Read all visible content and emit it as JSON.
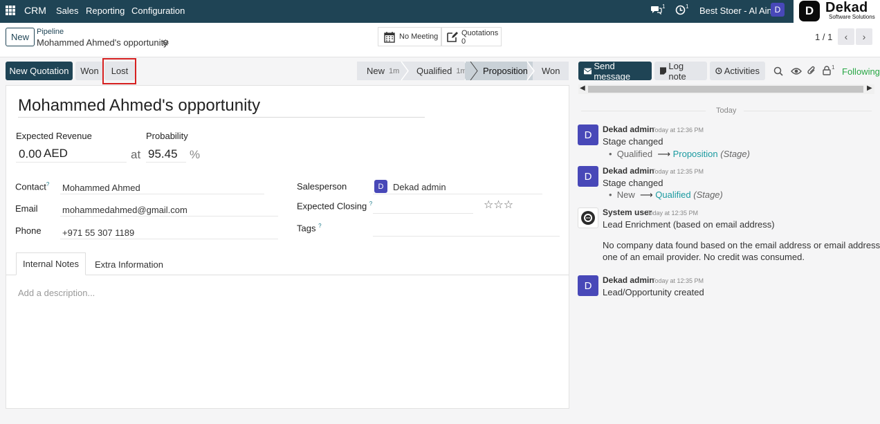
{
  "navbar": {
    "brand": "CRM",
    "menu": [
      "Sales",
      "Reporting",
      "Configuration"
    ],
    "messages_count": "1",
    "activities_count": "1",
    "company": "Best Stoer - Al Ain",
    "user_initial": "D",
    "logo_initial": "D",
    "logo_name": "Dekad",
    "logo_sub": "Software Solutions"
  },
  "control": {
    "new_label": "New",
    "breadcrumb_parent": "Pipeline",
    "breadcrumb_current": "Mohammed Ahmed's opportunity",
    "meeting_label": "No Meeting",
    "quotations_label": "Quotations",
    "quotations_count": "0",
    "pager": "1 / 1"
  },
  "actions": {
    "new_quotation": "New Quotation",
    "won": "Won",
    "lost": "Lost"
  },
  "stages": [
    {
      "name": "New",
      "duration": "1m"
    },
    {
      "name": "Qualified",
      "duration": "1m"
    },
    {
      "name": "Proposition",
      "duration": ""
    },
    {
      "name": "Won",
      "duration": ""
    }
  ],
  "form": {
    "title": "Mohammed Ahmed's opportunity",
    "expected_revenue_label": "Expected Revenue",
    "expected_revenue": "0.00",
    "currency": "AED",
    "at": "at",
    "probability_label": "Probability",
    "probability": "95.45",
    "percent": "%",
    "contact_label": "Contact",
    "contact": "Mohammed Ahmed",
    "email_label": "Email",
    "email": "mohammedahmed@gmail.com",
    "phone_label": "Phone",
    "phone": "+971 55 307 1189",
    "salesperson_label": "Salesperson",
    "salesperson": "Dekad admin",
    "salesperson_initial": "D",
    "expected_closing_label": "Expected Closing",
    "tags_label": "Tags",
    "help": "?",
    "tabs": [
      "Internal Notes",
      "Extra Information"
    ],
    "description_placeholder": "Add a description..."
  },
  "chatter": {
    "send_message": "Send message",
    "log_note": "Log note",
    "activities": "Activities",
    "followers_count": "1",
    "following": "Following",
    "today": "Today",
    "messages": [
      {
        "author": "Dekad admin",
        "time": "Today at 12:36 PM",
        "initial": "D",
        "text": "Stage changed",
        "from": "Qualified",
        "to": "Proposition",
        "field": "(Stage)"
      },
      {
        "author": "Dekad admin",
        "time": "Today at 12:35 PM",
        "initial": "D",
        "text": "Stage changed",
        "from": "New",
        "to": "Qualified",
        "field": "(Stage)"
      },
      {
        "author": "System user",
        "time": "Today at 12:35 PM",
        "text": "Lead Enrichment (based on email address)",
        "body1": "No company data found based on the email address or email address is",
        "body2": "one of an email provider. No credit was consumed."
      },
      {
        "author": "Dekad admin",
        "time": "Today at 12:35 PM",
        "initial": "D",
        "text": "Lead/Opportunity created"
      }
    ]
  }
}
